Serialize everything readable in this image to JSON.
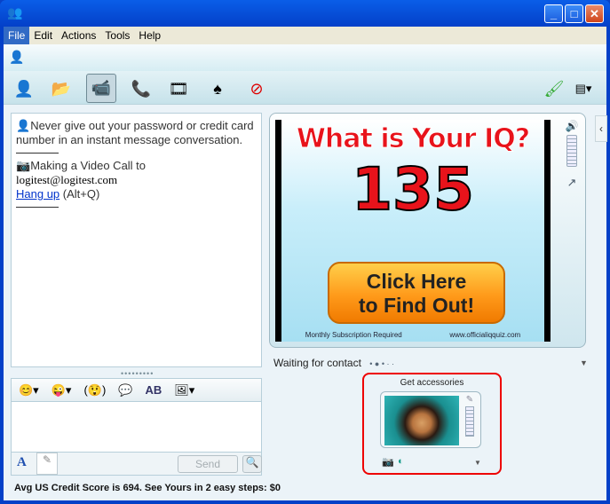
{
  "window": {
    "title": "",
    "controls": {
      "minimize": "_",
      "maximize": "□",
      "close": "✕"
    }
  },
  "menu": [
    "File",
    "Edit",
    "Actions",
    "Tools",
    "Help"
  ],
  "toolbar": {
    "icons": [
      "invite-contact-icon",
      "send-files-icon",
      "video-call-icon",
      "voice-call-icon",
      "activities-icon",
      "games-icon",
      "block-contact-icon"
    ],
    "right_icons": [
      "background-brush-icon",
      "display-options-icon"
    ]
  },
  "conversation": {
    "warning": "Never give out your password or credit card number in an instant message conversation.",
    "video_call": "Making a Video Call to",
    "contact": "logitest@logitest.com",
    "hangup_link": "Hang up",
    "hangup_shortcut": "(Alt+Q)"
  },
  "compose": {
    "send_label": "Send",
    "format_icons": [
      "emoticon-icon",
      "wink-icon",
      "nudge-icon",
      "voice-clip-icon",
      "font-icon",
      "background-icon"
    ]
  },
  "ad": {
    "title": "What is Your IQ?",
    "number": "135",
    "button_line1": "Click Here",
    "button_line2": "to Find Out!",
    "footer_left": "Monthly Subscription Required",
    "footer_right": "www.officialiqquiz.com"
  },
  "video": {
    "status": "Waiting for contact"
  },
  "accessories": {
    "title": "Get accessories"
  },
  "status_bar": {
    "text": "Avg US Credit Score is 694.  See Yours in 2 easy steps: $0"
  }
}
